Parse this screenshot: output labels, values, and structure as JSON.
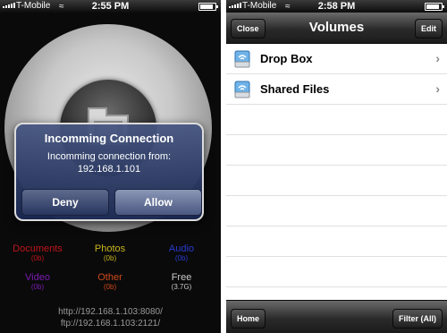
{
  "left": {
    "status": {
      "carrier": "T-Mobile",
      "time": "2:55 PM"
    },
    "alert": {
      "title": "Incomming Connection",
      "message_line1": "Incomming connection from:",
      "message_line2": "192.168.1.101",
      "deny_label": "Deny",
      "allow_label": "Allow"
    },
    "stats": [
      {
        "category": "Documents",
        "size": "(0b)",
        "color": "#c0141a"
      },
      {
        "category": "Photos",
        "size": "(0b)",
        "color": "#c8b41e"
      },
      {
        "category": "Audio",
        "size": "(0b)",
        "color": "#2a3bd0"
      },
      {
        "category": "Video",
        "size": "(0b)",
        "color": "#7a1bb0"
      },
      {
        "category": "Other",
        "size": "(0b)",
        "color": "#d0481a"
      },
      {
        "category": "Free",
        "size": "(3.7G)",
        "color": "#c8c8c8"
      }
    ],
    "urls": {
      "http": "http://192.168.1.103:8080/",
      "ftp": "ftp://192.168.1.103:2121/"
    }
  },
  "right": {
    "status": {
      "carrier": "T-Mobile",
      "time": "2:58 PM"
    },
    "navbar": {
      "title": "Volumes",
      "close_label": "Close",
      "edit_label": "Edit"
    },
    "volumes": [
      {
        "label": "Drop Box",
        "icon": "drive-icon"
      },
      {
        "label": "Shared Files",
        "icon": "drive-icon"
      }
    ],
    "toolbar": {
      "home_label": "Home",
      "filter_label": "Filter (All)"
    }
  }
}
